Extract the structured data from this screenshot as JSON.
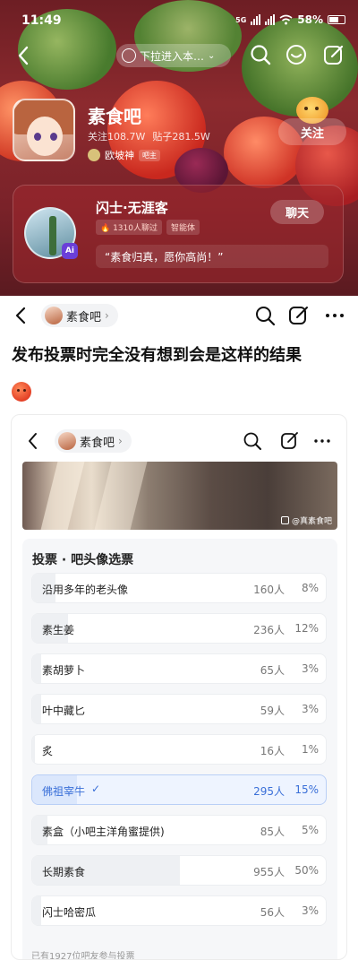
{
  "status_bar": {
    "time": "11:49",
    "battery": "58%",
    "network_tag": "5G"
  },
  "banner": {
    "pull_hint": "下拉进入本…",
    "forum_name": "素食吧",
    "stats": {
      "follows": "关注108.7W",
      "posts": "贴子281.5W"
    },
    "owner": {
      "name": "欧坡神",
      "tag": "吧主"
    },
    "follow_label": "关注"
  },
  "bot_card": {
    "name": "闪士·无涯客",
    "tags": [
      "🔥 1310人聊过",
      "智能体"
    ],
    "quote": "“素食归真，愿你高尚！”",
    "chat_label": "聊天",
    "ai_badge": "Ai"
  },
  "post": {
    "forum_chip": "素食吧",
    "title": "发布投票时完全没有想到会是这样的结果"
  },
  "embedded": {
    "forum_chip": "素食吧",
    "watermark": "@真素食吧",
    "poll": {
      "title": "投票 · 吧头像选票",
      "options": [
        {
          "label": "沿用多年的老头像",
          "count": "160人",
          "pct": "8%",
          "share": 0.08,
          "selected": false
        },
        {
          "label": "素生姜",
          "count": "236人",
          "pct": "12%",
          "share": 0.12,
          "selected": false
        },
        {
          "label": "素胡萝卜",
          "count": "65人",
          "pct": "3%",
          "share": 0.03,
          "selected": false
        },
        {
          "label": "叶中藏匕",
          "count": "59人",
          "pct": "3%",
          "share": 0.03,
          "selected": false
        },
        {
          "label": "炙",
          "count": "16人",
          "pct": "1%",
          "share": 0.01,
          "selected": false
        },
        {
          "label": "佛祖宰牛",
          "count": "295人",
          "pct": "15%",
          "share": 0.15,
          "selected": true
        },
        {
          "label": "素盒（小吧主洋角蜜提供)",
          "count": "85人",
          "pct": "5%",
          "share": 0.05,
          "selected": false
        },
        {
          "label": "长期素食",
          "count": "955人",
          "pct": "50%",
          "share": 0.5,
          "selected": false
        },
        {
          "label": "闪士哈密瓜",
          "count": "56人",
          "pct": "3%",
          "share": 0.03,
          "selected": false
        }
      ],
      "footer": "已有1927位吧友参与投票"
    }
  }
}
